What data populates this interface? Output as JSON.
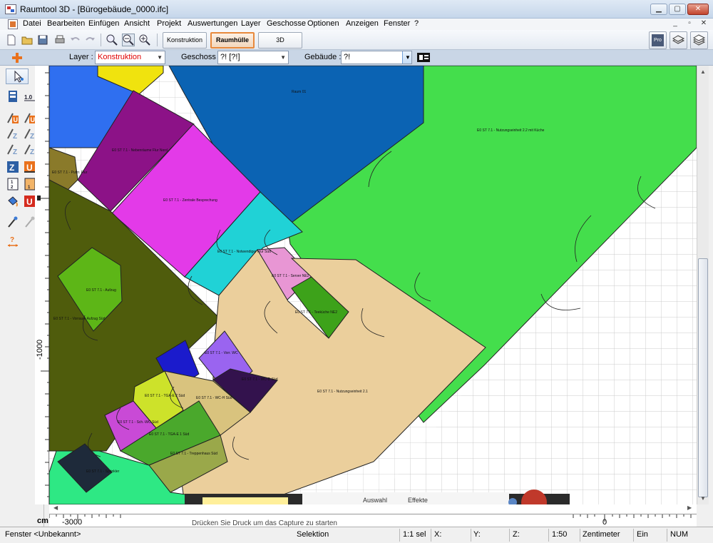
{
  "window": {
    "title": "Raumtool 3D - [Bürogebäude_0000.ifc]",
    "minimize": "▁",
    "maximize": "▢",
    "close": "✕"
  },
  "menu": [
    "Datei",
    "Bearbeiten",
    "Einfügen",
    "Ansicht",
    "Projekt",
    "Auswertungen",
    "Layer",
    "Geschosse",
    "Optionen",
    "Anzeigen",
    "Fenster",
    "?"
  ],
  "mdi_controls": [
    "_",
    "▫",
    "✕"
  ],
  "toolbar": {
    "tabs": [
      "Konstruktion",
      "Raumhülle",
      "3D"
    ],
    "active_tab": "Raumhülle",
    "right_buttons": [
      "Pro",
      "layers-1-icon",
      "layers-2-icon"
    ]
  },
  "layerbar": {
    "layer_label": "Layer :",
    "layer_value": "Konstruktion",
    "geschoss_label": "Geschoss :",
    "geschoss_value": "?! [?!]",
    "gebaeude_label": "Gebäude :",
    "gebaeude_value": "?!"
  },
  "rulers": {
    "unit": "cm",
    "left_label": "-1000",
    "bottom_labels": [
      "-3000",
      "0"
    ]
  },
  "rooms": [
    {
      "label": "Raum 01",
      "color": "#0b63b3"
    },
    {
      "label": "E0 ST 7.1 - Nutzungseinheit 2.2 mit Küche",
      "color": "#44de4c"
    },
    {
      "label": "E0 ST 7.1 - Nebenräume Flur Nord",
      "color": "#8c1287"
    },
    {
      "label": "E0 ST 7.1 - Zentrale Besprechung",
      "color": "#e33ae8"
    },
    {
      "label": "E0 ST 7.1 - Notwendiger Flur Süd",
      "color": "#20d2d6"
    },
    {
      "label": "E0 ST 7.1 - Server NE2",
      "color": "#e896d4"
    },
    {
      "label": "E0 ST 7.1 - Teeküche NE2",
      "color": "#3da21a"
    },
    {
      "label": "E0 ST 7.1 - Nutzungseinheit 2.1",
      "color": "#ebcf9c"
    },
    {
      "label": "E0 ST 7.1 - Aufzug",
      "color": "#5db617"
    },
    {
      "label": "E0 ST 7.1 - Vorraum Aufzug Süd",
      "color": "#4f5c0c"
    },
    {
      "label": "E0 ST 7.1 - Putzr. Flur",
      "color": "#8a7a2a"
    },
    {
      "label": "E0 ST 7.1 - Vorr. WC",
      "color": "#9a64f0"
    },
    {
      "label": "E0 ST 7.1 - WC-D Süd",
      "color": "#33124d"
    },
    {
      "label": "E0 ST 7.1 - WC-H Süd",
      "color": "#d9c37e"
    },
    {
      "label": "E0 ST 7.1 - TGA-E 2 Süd",
      "color": "#cde22a"
    },
    {
      "label": "E0 ST 7.1 - Sch.-WC Süd",
      "color": "#c94ad6"
    },
    {
      "label": "E0 ST 7.1 - TGA-E 1 Süd",
      "color": "#4aa82c"
    },
    {
      "label": "E0 ST 7.1 - Treppenhaus Süd",
      "color": "#9aa84a"
    },
    {
      "label": "E0 ST 7.1 - Sprinkler",
      "color": "#1e2a3a"
    },
    {
      "label": "",
      "color": "#2ee884"
    },
    {
      "label": "",
      "color": "#1b1bcc"
    },
    {
      "label": "",
      "color": "#2f6ff0"
    },
    {
      "label": "",
      "color": "#f0e30e"
    }
  ],
  "behind_window": {
    "labels": [
      "Auswahl",
      "Effekte"
    ],
    "tooltip": "Drücken Sie  Druck  um das Capture zu starten"
  },
  "status": {
    "window": "Fenster <Unbekannt>",
    "mode": "Selektion",
    "scale_sel": "1:1 sel",
    "x": "X:",
    "y": "Y:",
    "z": "Z:",
    "scale": "1:50",
    "unit": "Zentimeter",
    "insert": "Ein",
    "num": "NUM"
  }
}
